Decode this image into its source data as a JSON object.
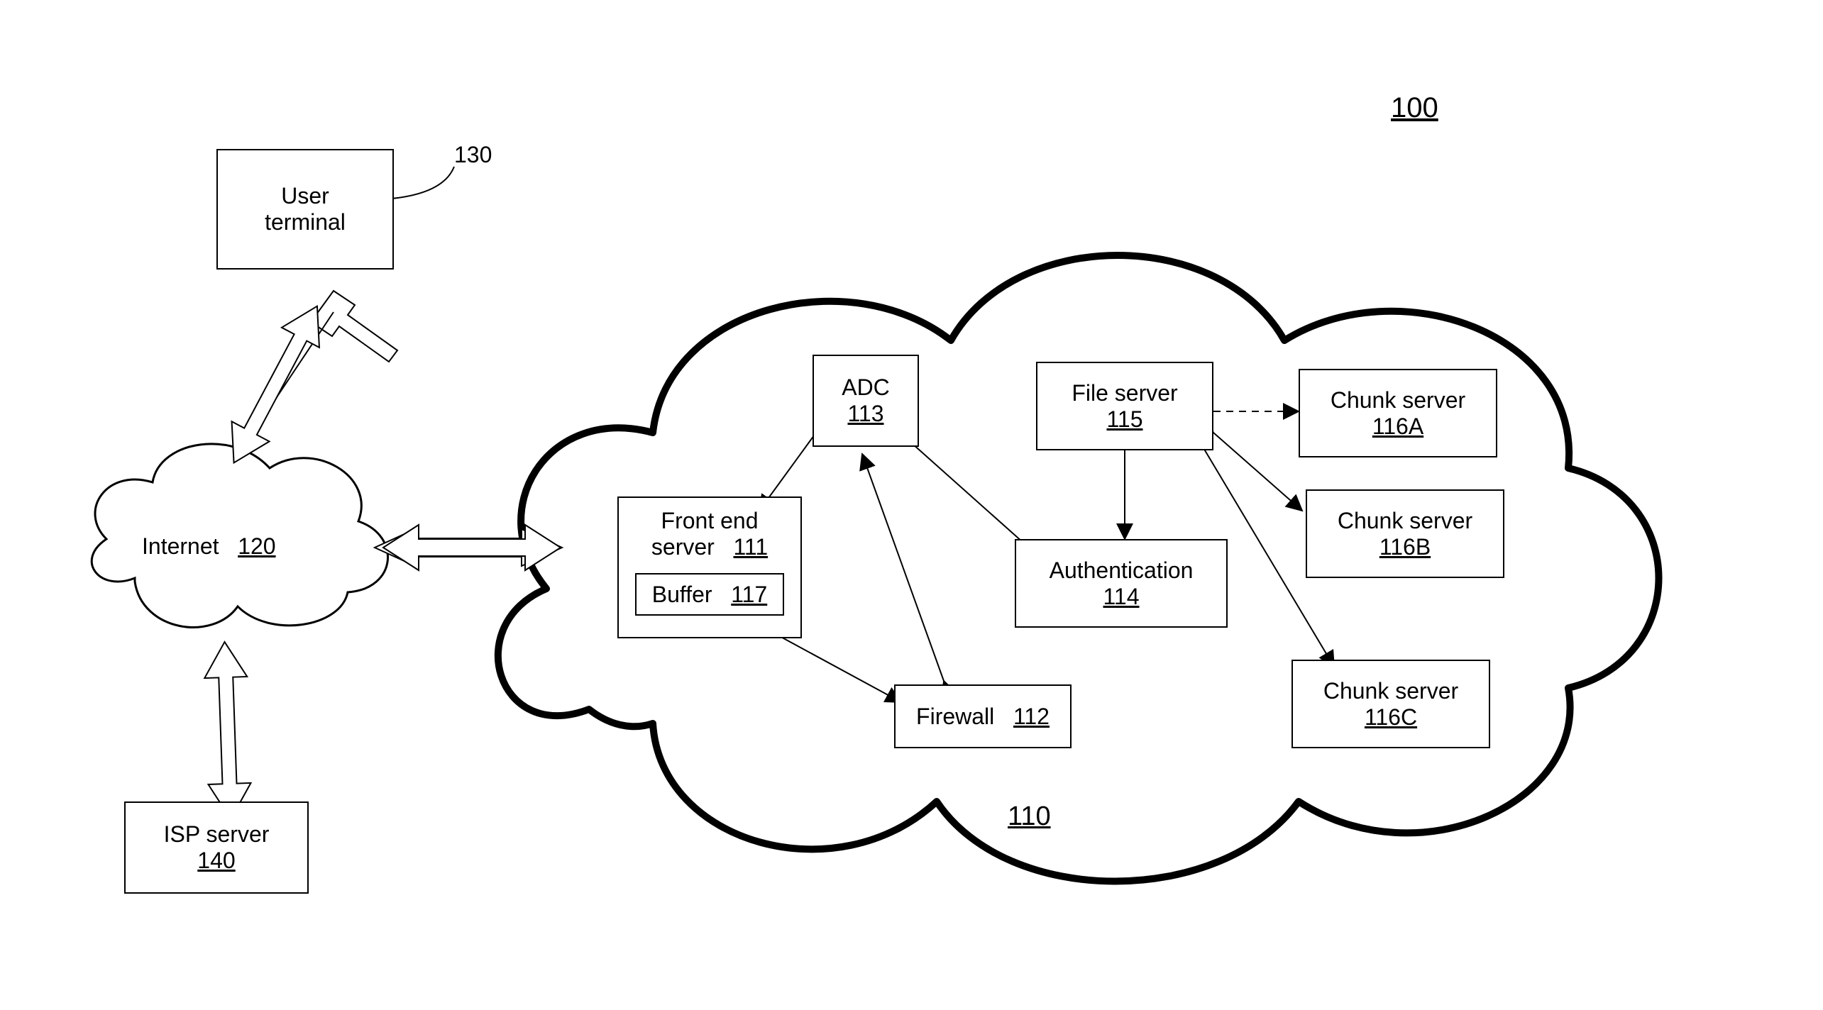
{
  "figure_ref": "100",
  "nodes": {
    "user_terminal": {
      "label": "User",
      "label2": "terminal",
      "ref": "130"
    },
    "internet": {
      "label": "Internet",
      "ref": "120"
    },
    "isp_server": {
      "label": "ISP server",
      "ref": "140"
    },
    "cloud_system": {
      "ref": "110"
    },
    "front_end": {
      "label": "Front end",
      "label2": "server",
      "ref": "111"
    },
    "buffer": {
      "label": "Buffer",
      "ref": "117"
    },
    "adc": {
      "label": "ADC",
      "ref": "113"
    },
    "firewall": {
      "label": "Firewall",
      "ref": "112"
    },
    "file_server": {
      "label": "File server",
      "ref": "115"
    },
    "auth": {
      "label": "Authentication",
      "ref": "114"
    },
    "chunk_a": {
      "label": "Chunk server",
      "ref": "116A"
    },
    "chunk_b": {
      "label": "Chunk server",
      "ref": "116B"
    },
    "chunk_c": {
      "label": "Chunk server",
      "ref": "116C"
    }
  }
}
